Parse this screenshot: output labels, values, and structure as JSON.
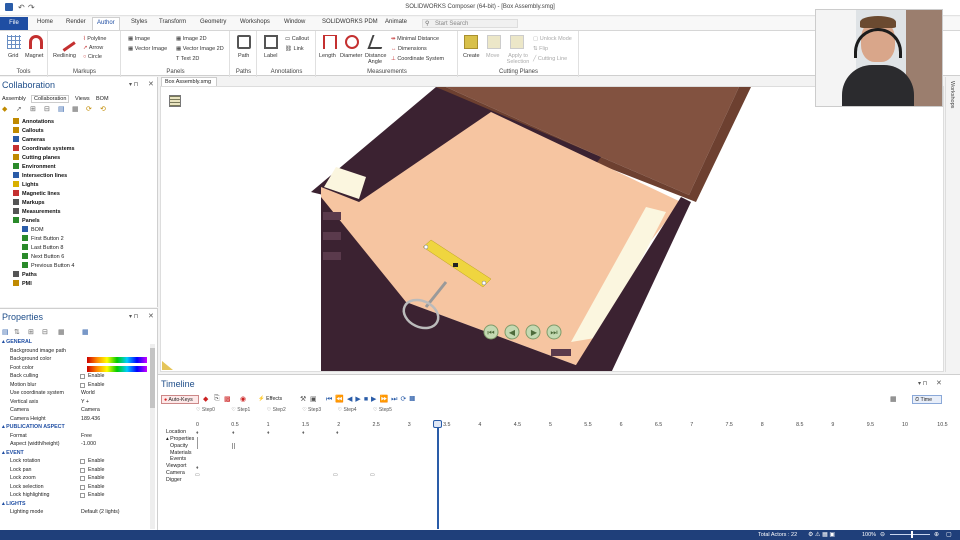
{
  "app_title": "SOLIDWORKS Composer (64-bit) - [Box Assembly.smg]",
  "menu_tabs": [
    "File",
    "Home",
    "Render",
    "Author",
    "Styles",
    "Transform",
    "Geometry",
    "Workshops",
    "Window",
    "SOLIDWORKS PDM",
    "Animate"
  ],
  "active_tab": "Author",
  "search_placeholder": "Start Search",
  "ribbon": {
    "tools": {
      "label": "Tools",
      "items": [
        "Grid",
        "Magnet"
      ]
    },
    "markups": {
      "label": "Markups",
      "items": [
        "Redlining",
        "Polyline",
        "Arrow",
        "Circle"
      ]
    },
    "panels": {
      "label": "Panels",
      "items": [
        "Image",
        "Vector Image",
        "Image 2D",
        "Vector Image 2D",
        "Text 2D"
      ]
    },
    "paths": {
      "label": "Paths",
      "items": [
        "Path"
      ]
    },
    "annotations": {
      "label": "Annotations",
      "items": [
        "Label",
        "Callout",
        "Link"
      ]
    },
    "measurements": {
      "label": "Measurements",
      "items": [
        "Length",
        "Diameter",
        "Distance",
        "Angle",
        "Minimal Distance",
        "Dimensions",
        "Coordinate System"
      ]
    },
    "cutting_planes": {
      "label": "Cutting Planes",
      "items": [
        "Create",
        "Move",
        "Apply to Selection",
        "Unlock Mode",
        "Flip",
        "Cutting Line"
      ]
    }
  },
  "left_panel": {
    "title": "Collaboration",
    "tabs": [
      "Assembly",
      "Collaboration",
      "Views",
      "BOM"
    ],
    "tree": [
      {
        "label": "Annotations",
        "bold": true,
        "indent": 0
      },
      {
        "label": "Callouts",
        "bold": true,
        "indent": 0
      },
      {
        "label": "Cameras",
        "bold": true,
        "indent": 0
      },
      {
        "label": "Coordinate systems",
        "bold": true,
        "indent": 0
      },
      {
        "label": "Cutting planes",
        "bold": true,
        "indent": 0
      },
      {
        "label": "Environment",
        "bold": true,
        "indent": 0
      },
      {
        "label": "Intersection lines",
        "bold": true,
        "indent": 0
      },
      {
        "label": "Lights",
        "bold": true,
        "indent": 0
      },
      {
        "label": "Magnetic lines",
        "bold": true,
        "indent": 0
      },
      {
        "label": "Markups",
        "bold": true,
        "indent": 0
      },
      {
        "label": "Measurements",
        "bold": true,
        "indent": 0
      },
      {
        "label": "Panels",
        "bold": true,
        "indent": 0
      },
      {
        "label": "BOM",
        "bold": false,
        "indent": 1
      },
      {
        "label": "First Button 2",
        "bold": false,
        "indent": 1
      },
      {
        "label": "Last Button 8",
        "bold": false,
        "indent": 1
      },
      {
        "label": "Next Button 6",
        "bold": false,
        "indent": 1
      },
      {
        "label": "Previous Button 4",
        "bold": false,
        "indent": 1
      },
      {
        "label": "Paths",
        "bold": true,
        "indent": 0
      },
      {
        "label": "PMI",
        "bold": true,
        "indent": 0
      }
    ]
  },
  "properties": {
    "title": "Properties",
    "sections": [
      {
        "name": "GENERAL",
        "rows": [
          {
            "k": "Background image path",
            "v": ""
          },
          {
            "k": "Background color",
            "v": ""
          },
          {
            "k": "Foot color",
            "v": ""
          },
          {
            "k": "Back culling",
            "v": "Enable"
          },
          {
            "k": "Motion blur",
            "v": "Enable"
          },
          {
            "k": "Use coordinate system",
            "v": "World"
          },
          {
            "k": "Vertical axis",
            "v": "Y +"
          },
          {
            "k": "Camera",
            "v": "Camera"
          },
          {
            "k": "Camera Height",
            "v": "189.436"
          }
        ]
      },
      {
        "name": "PUBLICATION ASPECT",
        "rows": [
          {
            "k": "Format",
            "v": "Free"
          },
          {
            "k": "Aspect (width/height)",
            "v": "-1.000"
          }
        ]
      },
      {
        "name": "EVENT",
        "rows": [
          {
            "k": "Lock rotation",
            "v": "Enable"
          },
          {
            "k": "Lock pan",
            "v": "Enable"
          },
          {
            "k": "Lock zoom",
            "v": "Enable"
          },
          {
            "k": "Lock selection",
            "v": "Enable"
          },
          {
            "k": "Lock highlighting",
            "v": "Enable"
          }
        ]
      },
      {
        "name": "LIGHTS",
        "rows": [
          {
            "k": "Lighting mode",
            "v": "Default (2 lights)"
          }
        ]
      }
    ]
  },
  "viewport_tab": "Box Assembly.smg",
  "workshops_label": "Workshops",
  "timeline": {
    "title": "Timeline",
    "auto_keys": "Auto-Keys",
    "effects": "Effects",
    "time_btn": "Time",
    "steps": [
      "Step0",
      "Step1",
      "Step2",
      "Step3",
      "Step4",
      "Step5"
    ],
    "ticks": [
      "0",
      "0.5",
      "1",
      "1.5",
      "2",
      "2.5",
      "3",
      "3.5",
      "4",
      "4.5",
      "5",
      "5.5",
      "6",
      "6.5",
      "7",
      "7.5",
      "8",
      "8.5",
      "9",
      "9.5",
      "10",
      "10.5"
    ],
    "tracks": [
      "Location",
      "Properties",
      "Opacity",
      "Materials",
      "Events",
      "Viewport",
      "Camera",
      "Digger"
    ]
  },
  "status": {
    "total_actors": "Total Actors : 22",
    "zoom": "100%"
  },
  "colors": {
    "accent": "#1f4ea3",
    "box_light": "#f6c5a1",
    "box_dark": "#3b2231",
    "box_lid": "#825240",
    "cream": "#fbf6df"
  }
}
